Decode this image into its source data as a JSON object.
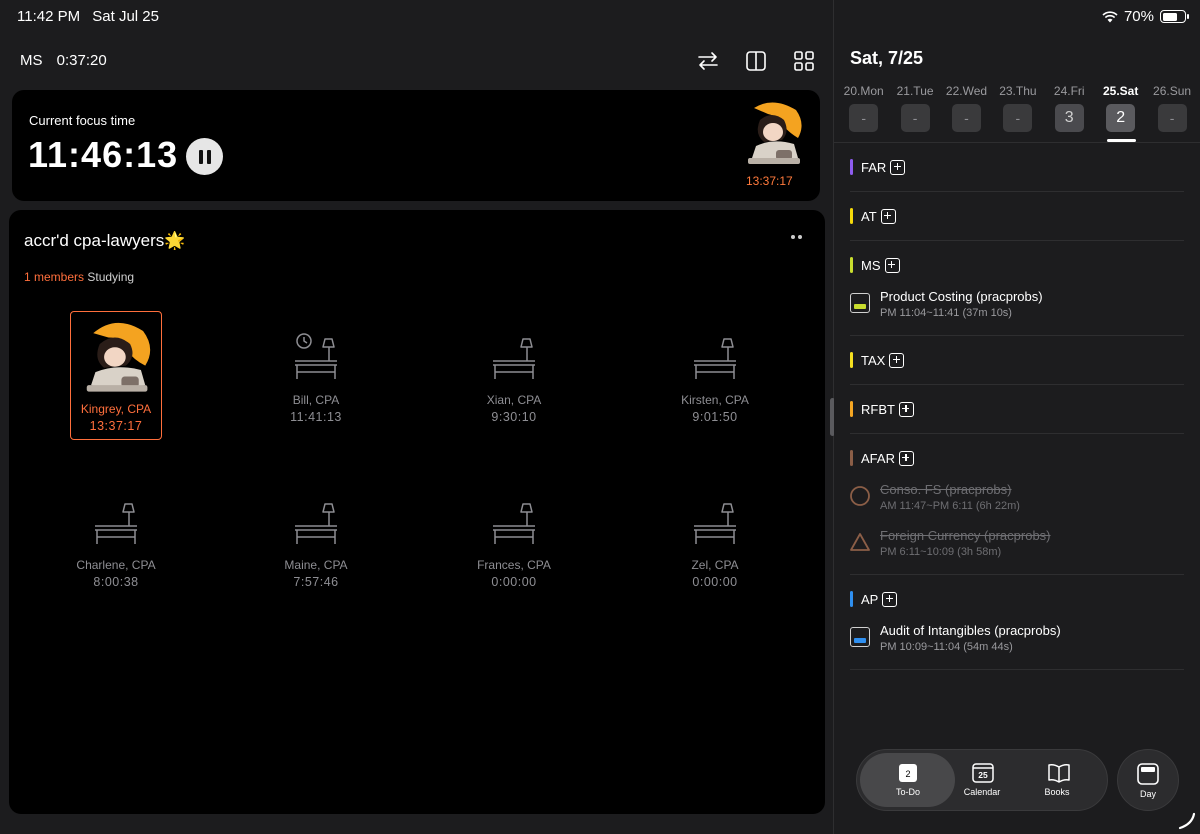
{
  "status": {
    "time": "11:42 PM",
    "date": "Sat Jul 25",
    "battery": "70%",
    "battery_level": 0.7
  },
  "header": {
    "subject": "MS",
    "elapsed": "0:37:20"
  },
  "focus": {
    "label": "Current focus time",
    "time": "11:46:13",
    "avatar_time": "13:37:17"
  },
  "group": {
    "title": "accr'd cpa-lawyers",
    "title_emoji": "🌟",
    "members_count": "1 members",
    "members_status": "Studying",
    "members": [
      {
        "name": "Kingrey, CPA",
        "time": "13:37:17",
        "state": "active"
      },
      {
        "name": "Bill, CPA",
        "time": "11:41:13",
        "state": "clock"
      },
      {
        "name": "Xian, CPA",
        "time": "9:30:10",
        "state": "idle"
      },
      {
        "name": "Kirsten, CPA",
        "time": "9:01:50",
        "state": "idle"
      },
      {
        "name": "Charlene, CPA",
        "time": "8:00:38",
        "state": "idle"
      },
      {
        "name": "Maine, CPA",
        "time": "7:57:46",
        "state": "idle"
      },
      {
        "name": "Frances, CPA",
        "time": "0:00:00",
        "state": "idle"
      },
      {
        "name": "Zel, CPA",
        "time": "0:00:00",
        "state": "idle"
      }
    ]
  },
  "calendar": {
    "title": "Sat, 7/25",
    "days": [
      {
        "label": "20.Mon",
        "value": "-"
      },
      {
        "label": "21.Tue",
        "value": "-"
      },
      {
        "label": "22.Wed",
        "value": "-"
      },
      {
        "label": "23.Thu",
        "value": "-"
      },
      {
        "label": "24.Fri",
        "value": "3"
      },
      {
        "label": "25.Sat",
        "value": "2"
      },
      {
        "label": "26.Sun",
        "value": "-"
      }
    ]
  },
  "subjects": [
    {
      "name": "FAR",
      "color": "#8e5cf0",
      "tasks": []
    },
    {
      "name": "AT",
      "color": "#f5d90a",
      "tasks": []
    },
    {
      "name": "MS",
      "color": "#c9dd2e",
      "tasks": [
        {
          "title": "Product Costing (pracprobs)",
          "sub": "PM 11:04~11:41 (37m 10s)",
          "icon": "box",
          "done": false
        }
      ]
    },
    {
      "name": "TAX",
      "color": "#f5e020",
      "tasks": []
    },
    {
      "name": "RFBT",
      "color": "#f5a623",
      "tasks": []
    },
    {
      "name": "AFAR",
      "color": "#8b5e47",
      "tasks": [
        {
          "title": "Conso. FS (pracprobs)",
          "sub": "AM 11:47~PM 6:11 (6h 22m)",
          "icon": "circle",
          "done": true
        },
        {
          "title": "Foreign Currency (pracprobs)",
          "sub": "PM 6:11~10:09 (3h 58m)",
          "icon": "triangle",
          "done": true
        }
      ]
    },
    {
      "name": "AP",
      "color": "#2f8ff0",
      "tasks": [
        {
          "title": "Audit of Intangibles (pracprobs)",
          "sub": "PM 10:09~11:04 (54m 44s)",
          "icon": "box",
          "done": false
        }
      ]
    }
  ],
  "nav": {
    "todo_badge": "2",
    "todo": "To-Do",
    "calendar_badge": "25",
    "calendar": "Calendar",
    "books": "Books",
    "day": "Day"
  }
}
